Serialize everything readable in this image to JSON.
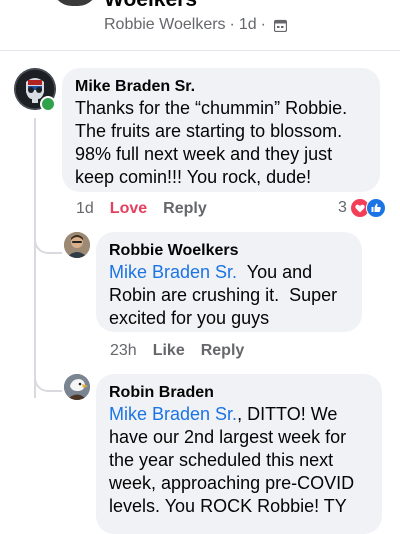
{
  "prev_post": {
    "author": "Woelkers",
    "meta_name": "Robbie Woelkers",
    "meta_time": "1d",
    "separator": "·"
  },
  "comments": [
    {
      "author": "Mike Braden Sr.",
      "text": "Thanks for the “chummin” Robbie. The fruits are starting to blossom. 98% full next week and they just keep comin!!! You rock, dude!",
      "time": "1d",
      "reaction_label": "Love",
      "reply_label": "Reply",
      "reaction_count": "3"
    },
    {
      "author": "Robbie Woelkers",
      "mention": "Mike Braden Sr.",
      "text_after_mention": "  You and Robin are crushing it.  Super excited for you guys",
      "time": "23h",
      "like_label": "Like",
      "reply_label": "Reply"
    },
    {
      "author": "Robin Braden",
      "mention": "Mike Braden Sr.",
      "text_after_mention": ", DITTO! We have our 2nd largest week for the year scheduled this next week, approaching pre-COVID levels. You ROCK Robbie! TY"
    }
  ],
  "colors": {
    "bubble": "#f0f2f5",
    "mention": "#1b74e4",
    "love": "#e4405f",
    "meta": "#65676b",
    "online": "#31a24c"
  }
}
